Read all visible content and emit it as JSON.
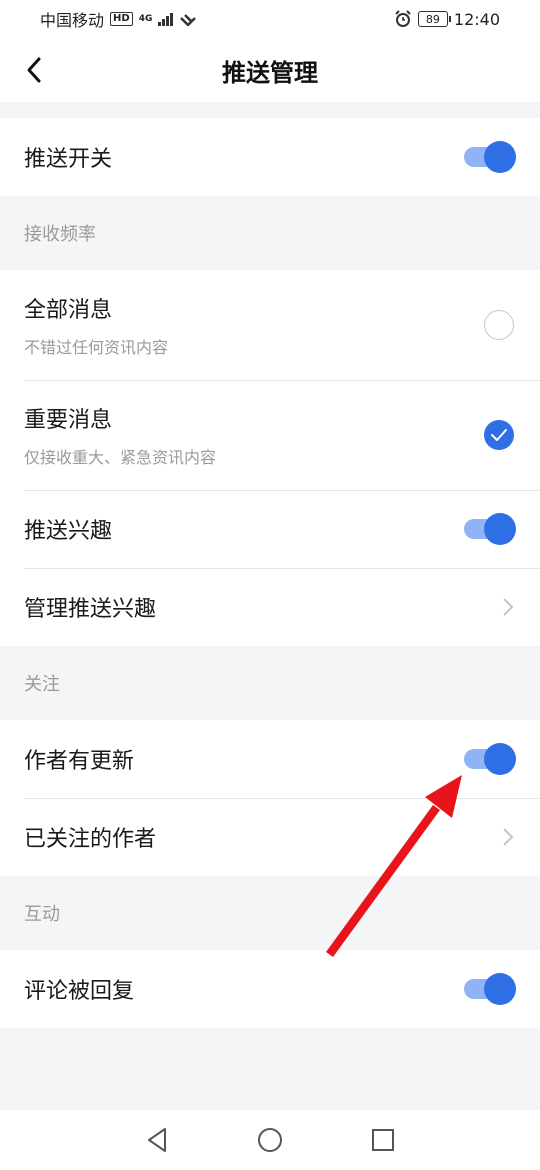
{
  "status_bar": {
    "carrier": "中国移动",
    "hd_badge": "HD",
    "network": "4G",
    "battery": "89",
    "time": "12:40"
  },
  "nav": {
    "title": "推送管理"
  },
  "push_switch": {
    "label": "推送开关",
    "on": true
  },
  "frequency": {
    "header": "接收频率",
    "all": {
      "label": "全部消息",
      "desc": "不错过任何资讯内容",
      "checked": false
    },
    "important": {
      "label": "重要消息",
      "desc": "仅接收重大、紧急资讯内容",
      "checked": true
    },
    "interest": {
      "label": "推送兴趣",
      "on": true
    },
    "manage_interest": {
      "label": "管理推送兴趣"
    }
  },
  "follow": {
    "header": "关注",
    "author_update": {
      "label": "作者有更新",
      "on": true
    },
    "followed_authors": {
      "label": "已关注的作者"
    }
  },
  "interaction": {
    "header": "互动",
    "comment_reply": {
      "label": "评论被回复",
      "on": true
    }
  },
  "colors": {
    "accent": "#2f6fe6",
    "accent_light": "#8fb3f4",
    "annotation_arrow": "#e8141b"
  },
  "icons": {
    "back": "chevron-left-icon",
    "chevron": "chevron-right-icon",
    "check": "check-icon",
    "nav_back": "triangle-back-icon",
    "nav_home": "circle-home-icon",
    "nav_recent": "square-recent-icon"
  }
}
